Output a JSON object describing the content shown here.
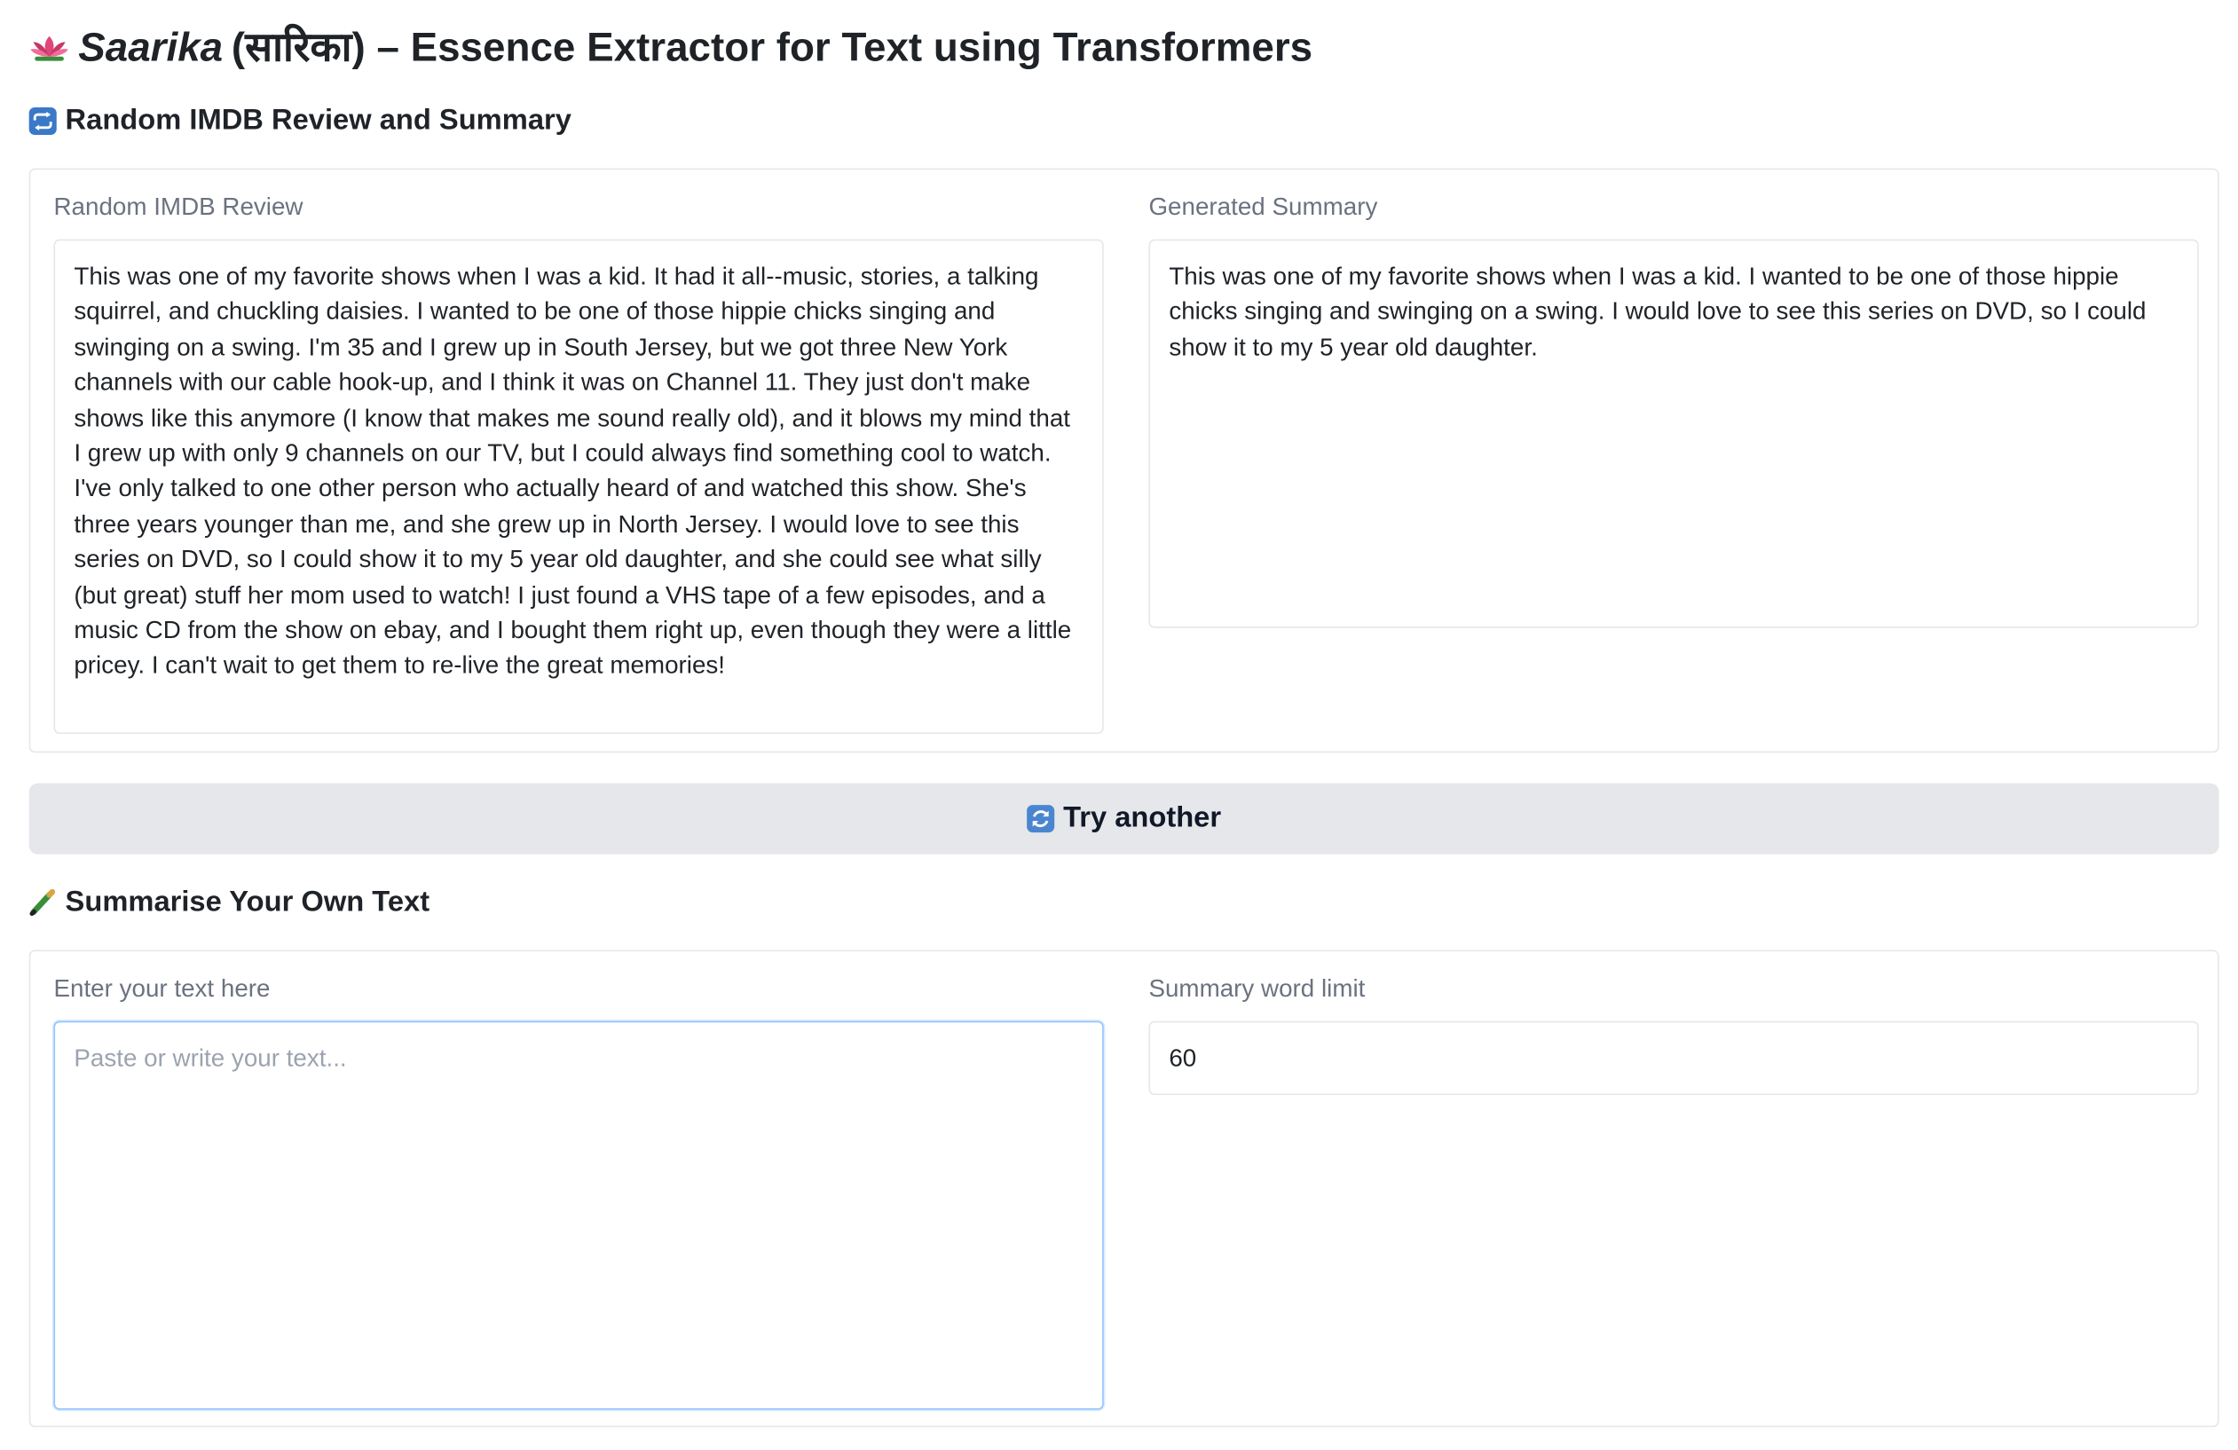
{
  "header": {
    "title_prefix": "Saarika",
    "title_rest": "(सारिका) – Essence Extractor for Text using Transformers",
    "title_icon": "lotus-icon"
  },
  "random_section": {
    "title": "Random IMDB Review and Summary",
    "title_icon": "repeat-icon",
    "review_label": "Random IMDB Review",
    "review_text": "This was one of my favorite shows when I was a kid. It had it all--music, stories, a talking squirrel, and chuckling daisies. I wanted to be one of those hippie chicks singing and swinging on a swing. I'm 35 and I grew up in South Jersey, but we got three New York channels with our cable hook-up, and I think it was on Channel 11. They just don't make shows like this anymore (I know that makes me sound really old), and it blows my mind that I grew up with only 9 channels on our TV, but I could always find something cool to watch. I've only talked to one other person who actually heard of and watched this show. She's three years younger than me, and she grew up in North Jersey. I would love to see this series on DVD, so I could show it to my 5 year old daughter, and she could see what silly (but great) stuff her mom used to watch! I just found a VHS tape of a few episodes, and a music CD from the show on ebay, and I bought them right up, even though they were a little pricey. I can't wait to get them to re-live the great memories!",
    "summary_label": "Generated Summary",
    "summary_text": "This was one of my favorite shows when I was a kid. I wanted to be one of those hippie chicks singing and swinging on a swing. I would love to see this series on DVD, so I could show it to my 5 year old daughter."
  },
  "try_button": {
    "label": "Try another",
    "icon": "refresh-icon"
  },
  "own_section": {
    "title": "Summarise Your Own Text",
    "title_icon": "pen-icon",
    "input_label": "Enter your text here",
    "input_placeholder": "Paste or write your text...",
    "input_value": "",
    "limit_label": "Summary word limit",
    "limit_value": "60"
  },
  "colors": {
    "accent_border": "#93c5fd",
    "button_bg": "#e5e7eb",
    "label_gray": "#6b7280"
  }
}
